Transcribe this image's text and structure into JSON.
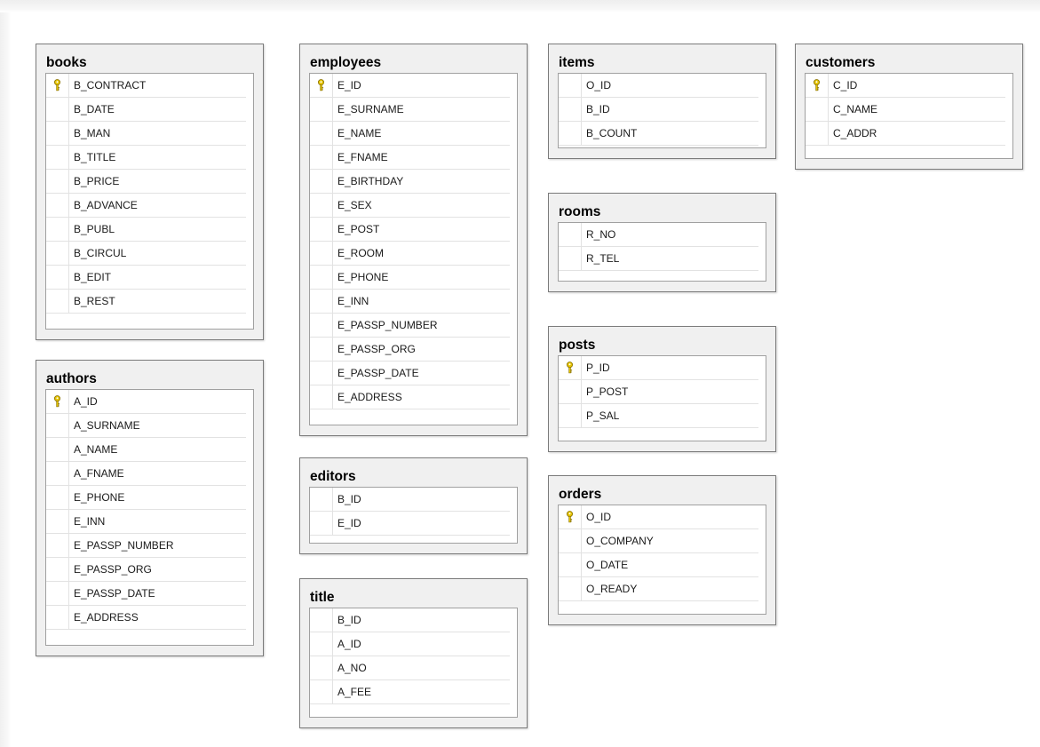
{
  "colors": {
    "canvas": "#ffffff",
    "table_frame": "#f0f0f0",
    "table_border": "#7b7b7b",
    "key_icon": "#e6c400"
  },
  "tables": [
    {
      "id": "books",
      "name": "books",
      "columns": [
        {
          "name": "B_CONTRACT",
          "primary_key": true
        },
        {
          "name": "B_DATE"
        },
        {
          "name": "B_MAN"
        },
        {
          "name": "B_TITLE"
        },
        {
          "name": "B_PRICE"
        },
        {
          "name": "B_ADVANCE"
        },
        {
          "name": "B_PUBL"
        },
        {
          "name": "B_CIRCUL"
        },
        {
          "name": "B_EDIT"
        },
        {
          "name": "B_REST"
        }
      ]
    },
    {
      "id": "authors",
      "name": "authors",
      "columns": [
        {
          "name": "A_ID",
          "primary_key": true
        },
        {
          "name": "A_SURNAME"
        },
        {
          "name": "A_NAME"
        },
        {
          "name": "A_FNAME"
        },
        {
          "name": "E_PHONE"
        },
        {
          "name": "E_INN"
        },
        {
          "name": "E_PASSP_NUMBER"
        },
        {
          "name": "E_PASSP_ORG"
        },
        {
          "name": "E_PASSP_DATE"
        },
        {
          "name": "E_ADDRESS"
        }
      ]
    },
    {
      "id": "employees",
      "name": "employees",
      "columns": [
        {
          "name": "E_ID",
          "primary_key": true
        },
        {
          "name": "E_SURNAME"
        },
        {
          "name": "E_NAME"
        },
        {
          "name": "E_FNAME"
        },
        {
          "name": "E_BIRTHDAY"
        },
        {
          "name": "E_SEX"
        },
        {
          "name": "E_POST"
        },
        {
          "name": "E_ROOM"
        },
        {
          "name": "E_PHONE"
        },
        {
          "name": "E_INN"
        },
        {
          "name": "E_PASSP_NUMBER"
        },
        {
          "name": "E_PASSP_ORG"
        },
        {
          "name": "E_PASSP_DATE"
        },
        {
          "name": "E_ADDRESS"
        }
      ]
    },
    {
      "id": "editors",
      "name": "editors",
      "columns": [
        {
          "name": "B_ID"
        },
        {
          "name": "E_ID"
        }
      ]
    },
    {
      "id": "title",
      "name": "title",
      "columns": [
        {
          "name": "B_ID"
        },
        {
          "name": "A_ID"
        },
        {
          "name": "A_NO"
        },
        {
          "name": "A_FEE"
        }
      ]
    },
    {
      "id": "items",
      "name": "items",
      "columns": [
        {
          "name": "O_ID"
        },
        {
          "name": "B_ID"
        },
        {
          "name": "B_COUNT"
        }
      ]
    },
    {
      "id": "rooms",
      "name": "rooms",
      "columns": [
        {
          "name": "R_NO"
        },
        {
          "name": "R_TEL"
        }
      ]
    },
    {
      "id": "posts",
      "name": "posts",
      "columns": [
        {
          "name": "P_ID",
          "primary_key": true
        },
        {
          "name": "P_POST"
        },
        {
          "name": "P_SAL"
        }
      ]
    },
    {
      "id": "orders",
      "name": "orders",
      "columns": [
        {
          "name": "O_ID",
          "primary_key": true
        },
        {
          "name": "O_COMPANY"
        },
        {
          "name": "O_DATE"
        },
        {
          "name": "O_READY"
        }
      ]
    },
    {
      "id": "customers",
      "name": "customers",
      "columns": [
        {
          "name": "C_ID",
          "primary_key": true
        },
        {
          "name": "C_NAME"
        },
        {
          "name": "C_ADDR"
        }
      ]
    }
  ]
}
